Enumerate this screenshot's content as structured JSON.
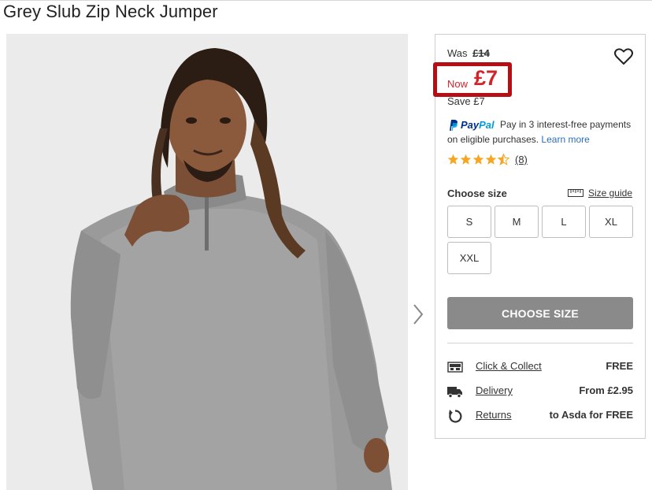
{
  "product": {
    "title": "Grey Slub Zip Neck Jumper"
  },
  "price": {
    "was_label": "Was",
    "was_value": "£14",
    "now_label": "Now",
    "now_value": "£7",
    "save_text": "Save £7",
    "accent_color": "#d2232a",
    "highlight_color": "#b50f16"
  },
  "paypal": {
    "logo_pay": "Pay",
    "logo_pal": "Pal",
    "text": "Pay in 3 interest-free payments on eligible purchases.",
    "link": "Learn more"
  },
  "rating": {
    "value": 4.5,
    "max": 5,
    "count_label": "(8)",
    "star_color": "#f5a623"
  },
  "size_picker": {
    "label": "Choose size",
    "guide_label": "Size guide",
    "guide_icon": "ruler-icon",
    "options": [
      "S",
      "M",
      "L",
      "XL",
      "XXL"
    ]
  },
  "cta": {
    "label": "CHOOSE SIZE",
    "color": "#8a8a8a"
  },
  "services": [
    {
      "icon": "store-icon",
      "label": "Click & Collect",
      "value": "FREE"
    },
    {
      "icon": "truck-icon",
      "label": "Delivery",
      "value": "From £2.95"
    },
    {
      "icon": "return-icon",
      "label": "Returns",
      "value": "to Asda for FREE"
    }
  ],
  "icons": {
    "wishlist": "heart-icon",
    "carousel_next": "chevron-right-icon"
  }
}
